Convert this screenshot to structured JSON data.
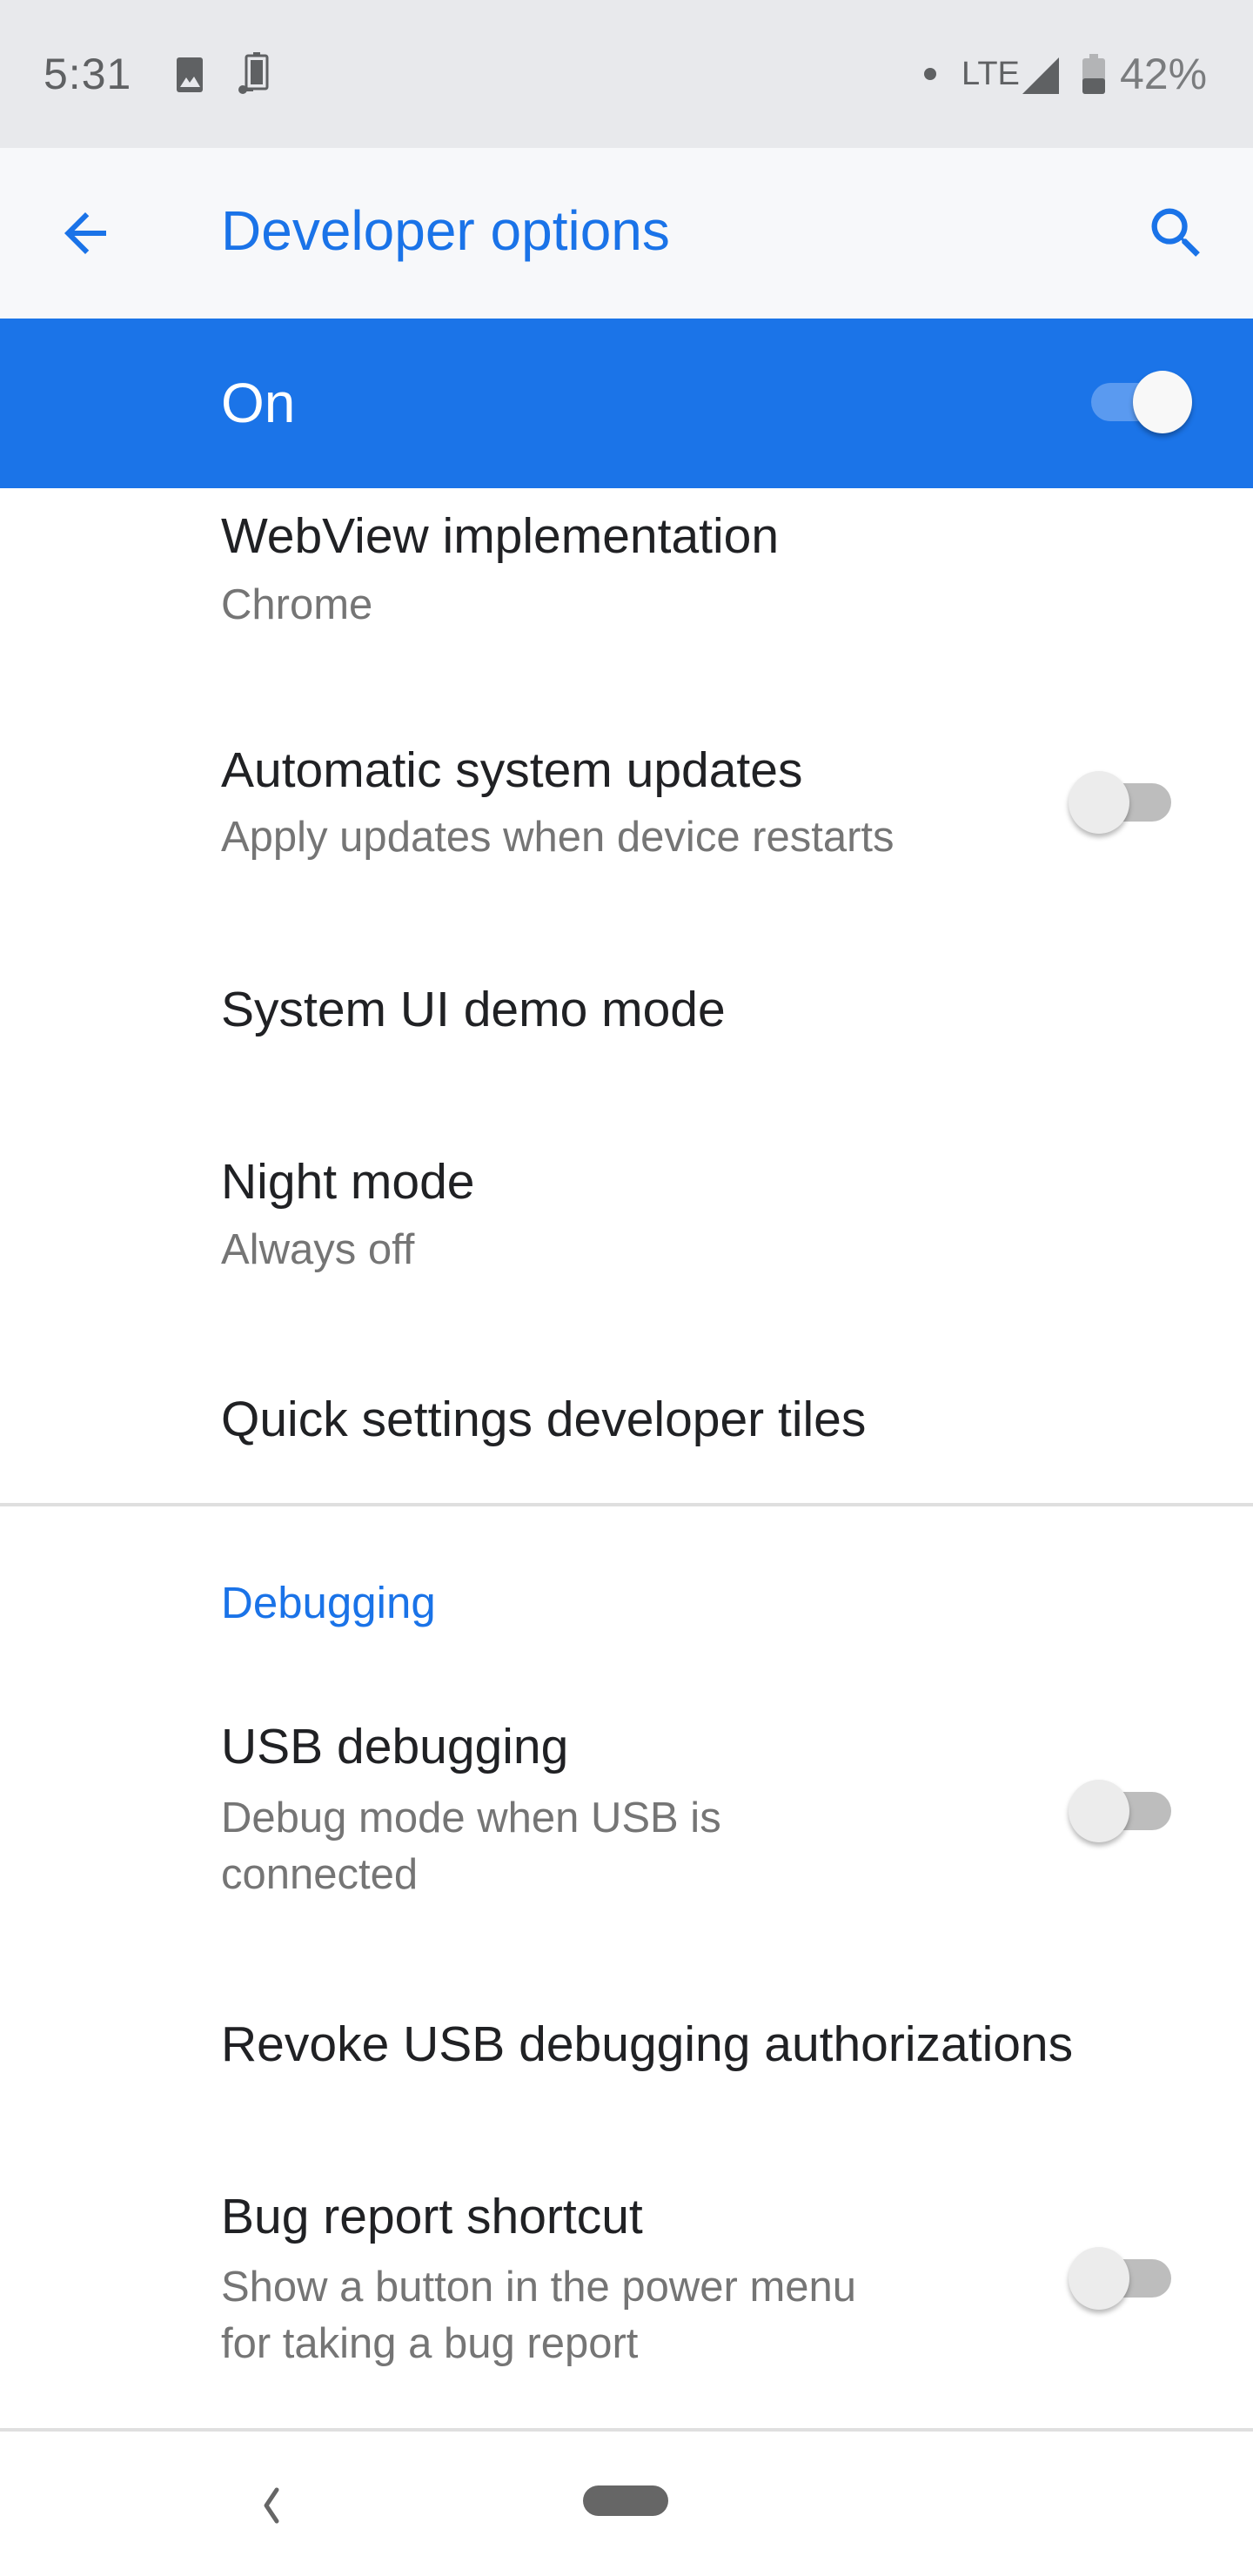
{
  "status_bar": {
    "time": "5:31",
    "notification_icons": [
      "image-icon",
      "battery-saver-usb-icon"
    ],
    "dot": "•",
    "network": "LTE",
    "signal_icon": "cell-signal-icon",
    "battery_icon": "battery-icon",
    "battery_percent": "42%",
    "battery_level": 0.42
  },
  "toolbar": {
    "back_icon": "arrow-back-icon",
    "title": "Developer options",
    "search_icon": "search-icon"
  },
  "master_switch": {
    "label": "On",
    "checked": true
  },
  "settings": [
    {
      "title": "WebView implementation",
      "subtitle": "Chrome"
    },
    {
      "title": "Automatic system updates",
      "subtitle": "Apply updates when device restarts",
      "toggle": false
    },
    {
      "title": "System UI demo mode"
    },
    {
      "title": "Night mode",
      "subtitle": "Always off"
    },
    {
      "title": "Quick settings developer tiles"
    }
  ],
  "debugging_section": {
    "header": "Debugging",
    "items": [
      {
        "title": "USB debugging",
        "subtitle_line1": "Debug mode when USB is",
        "subtitle_line2": "connected",
        "toggle": false
      },
      {
        "title": "Revoke USB debugging authorizations"
      },
      {
        "title": "Bug report shortcut",
        "subtitle_line1": "Show a button in the power menu",
        "subtitle_line2": "for taking a bug report",
        "toggle": false
      }
    ]
  },
  "nav_bar": {
    "back_icon": "nav-back-icon",
    "home_icon": "home-pill-icon"
  },
  "colors": {
    "accent": "#1a73e8",
    "master_bar": "#1b74e8",
    "status_bar_bg": "#e8e9ec",
    "toolbar_bg": "#f7f8fa",
    "primary_text": "#202124",
    "secondary_text": "#757575"
  }
}
